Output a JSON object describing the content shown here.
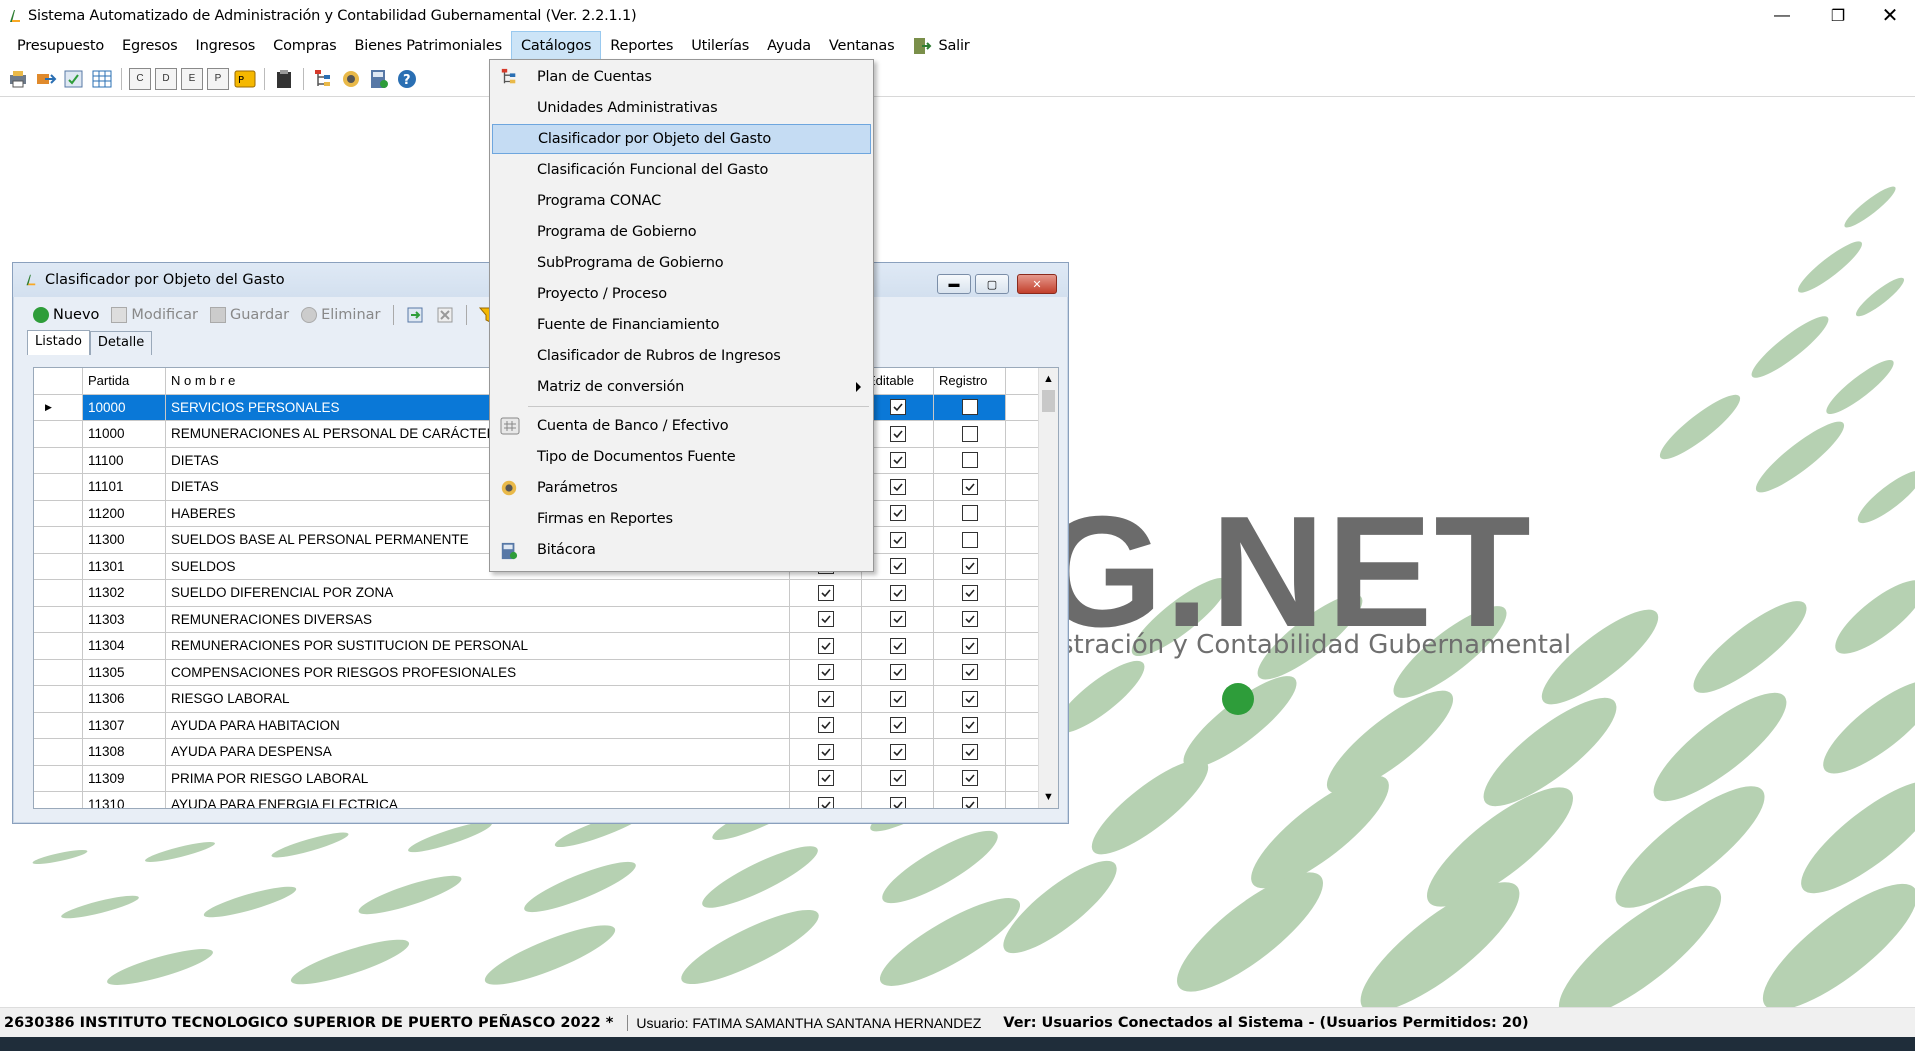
{
  "app": {
    "title": "Sistema Automatizado de Administración y Contabilidad Gubernamental  (Ver. 2.2.1.1)"
  },
  "menu": [
    "Presupuesto",
    "Egresos",
    "Ingresos",
    "Compras",
    "Bienes Patrimoniales",
    "Catálogos",
    "Reportes",
    "Utilerías",
    "Ayuda",
    "Ventanas",
    "Salir"
  ],
  "toolbar": {
    "small_buttons": [
      "C",
      "D",
      "E",
      "P"
    ]
  },
  "child": {
    "title": "Clasificador por Objeto del Gasto",
    "toolbar": {
      "nuevo": "Nuevo",
      "modificar": "Modificar",
      "guardar": "Guardar",
      "eliminar": "Eliminar"
    },
    "tabs": [
      "Listado",
      "Detalle"
    ],
    "columns": {
      "partida": "Partida",
      "nombre": "N o m b r e",
      "editable": "Editable",
      "registro": "Registro"
    },
    "rows": [
      {
        "partida": "10000",
        "nombre": "SERVICIOS PERSONALES",
        "c1": true,
        "c2": true,
        "c3": false
      },
      {
        "partida": "11000",
        "nombre": "REMUNERACIONES AL PERSONAL DE CARÁCTER P",
        "c1": true,
        "c2": true,
        "c3": false
      },
      {
        "partida": "11100",
        "nombre": "DIETAS",
        "c1": true,
        "c2": true,
        "c3": false
      },
      {
        "partida": "11101",
        "nombre": "DIETAS",
        "c1": true,
        "c2": true,
        "c3": true
      },
      {
        "partida": "11200",
        "nombre": "HABERES",
        "c1": true,
        "c2": true,
        "c3": false
      },
      {
        "partida": "11300",
        "nombre": "SUELDOS BASE AL PERSONAL PERMANENTE",
        "c1": true,
        "c2": true,
        "c3": false
      },
      {
        "partida": "11301",
        "nombre": "SUELDOS",
        "c1": true,
        "c2": true,
        "c3": true
      },
      {
        "partida": "11302",
        "nombre": "SUELDO DIFERENCIAL POR ZONA",
        "c1": true,
        "c2": true,
        "c3": true
      },
      {
        "partida": "11303",
        "nombre": "REMUNERACIONES DIVERSAS",
        "c1": true,
        "c2": true,
        "c3": true
      },
      {
        "partida": "11304",
        "nombre": "REMUNERACIONES POR SUSTITUCION DE PERSONAL",
        "c1": true,
        "c2": true,
        "c3": true
      },
      {
        "partida": "11305",
        "nombre": "COMPENSACIONES POR RIESGOS PROFESIONALES",
        "c1": true,
        "c2": true,
        "c3": true
      },
      {
        "partida": "11306",
        "nombre": "RIESGO LABORAL",
        "c1": true,
        "c2": true,
        "c3": true
      },
      {
        "partida": "11307",
        "nombre": "AYUDA PARA HABITACION",
        "c1": true,
        "c2": true,
        "c3": true
      },
      {
        "partida": "11308",
        "nombre": "AYUDA PARA DESPENSA",
        "c1": true,
        "c2": true,
        "c3": true
      },
      {
        "partida": "11309",
        "nombre": "PRIMA POR RIESGO LABORAL",
        "c1": true,
        "c2": true,
        "c3": true
      },
      {
        "partida": "11310",
        "nombre": "AYUDA PARA ENERGIA ELECTRICA",
        "c1": true,
        "c2": true,
        "c3": true
      }
    ]
  },
  "dropdown": {
    "items": [
      "Plan de Cuentas",
      "Unidades Administrativas",
      "Clasificador por Objeto del Gasto",
      "Clasificación Funcional del Gasto",
      "Programa CONAC",
      "Programa de Gobierno",
      "SubPrograma de Gobierno",
      "Proyecto / Proceso",
      "Fuente de Financiamiento",
      "Clasificador de Rubros de Ingresos",
      "Matriz de conversión",
      "Cuenta de Banco / Efectivo",
      "Tipo de Documentos Fuente",
      "Parámetros",
      "Firmas en Reportes",
      "Bitácora"
    ],
    "highlighted": 2
  },
  "logo": {
    "text": "G.NET",
    "subtitle": "stración y Contabilidad Gubernamental"
  },
  "status": {
    "institution": "2630386 INSTITUTO TECNOLOGICO SUPERIOR DE PUERTO PEÑASCO  2022  *",
    "user": "Usuario: FATIMA SAMANTHA SANTANA HERNANDEZ",
    "version": "Ver: Usuarios Conectados al Sistema - (Usuarios Permitidos: 20)"
  },
  "colors": {
    "accent": "#0a78d7",
    "logo_green": "#4caf50",
    "menu_highlight": "#c5dcf3"
  }
}
